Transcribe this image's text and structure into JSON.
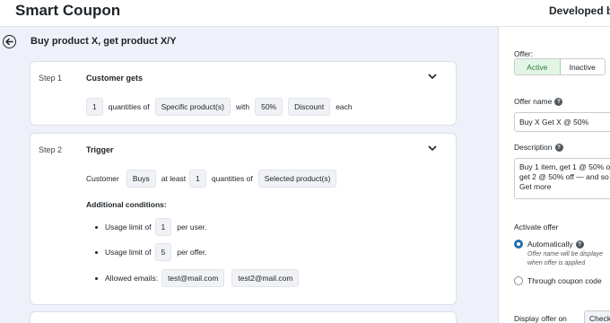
{
  "header": {
    "app_title": "Smart Coupon",
    "developed_by": "Developed by"
  },
  "page": {
    "title": "Buy product X, get product X/Y"
  },
  "step1": {
    "number": "Step 1",
    "name": "Customer gets",
    "quantity": "1",
    "t_quantities_of": "quantities of",
    "product": "Specific product(s)",
    "t_with": "with",
    "percent": "50%",
    "discount": "Discount",
    "t_each": "each"
  },
  "step2": {
    "number": "Step 2",
    "name": "Trigger",
    "t_customer": "Customer",
    "action": "Buys",
    "t_at_least": "at least",
    "quantity": "1",
    "t_quantities_of": "quantities of",
    "product": "Selected product(s)",
    "additional_title": "Additional conditions:",
    "usage_user": {
      "prefix": "Usage limit of",
      "value": "1",
      "suffix": "per user."
    },
    "usage_offer": {
      "prefix": "Usage limit of",
      "value": "5",
      "suffix": "per offer."
    },
    "emails": {
      "prefix": "Allowed emails:",
      "values": [
        "test@mail.com",
        "test2@mail.com"
      ]
    }
  },
  "sidebar": {
    "offer_label": "Offer:",
    "status_options": [
      "Active",
      "Inactive"
    ],
    "status_selected": "Active",
    "offer_name_label": "Offer name",
    "offer_name_value": "Buy X Get X @ 50%",
    "description_label": "Description",
    "description_lines": [
      "Buy 1 item, get 1 @ 50% o",
      "get 2 @ 50% off — and so",
      "Get more"
    ],
    "activate_label": "Activate offer",
    "radio_auto": "Automatically",
    "auto_hint_lines": [
      "Offer name will be displaye",
      "when offer is applied"
    ],
    "radio_coupon": "Through coupon code",
    "display_label": "Display offer on",
    "display_button": "Check"
  },
  "colors": {
    "accent": "#2271b1",
    "active_bg": "#e3f6e5",
    "active_text": "#2a7a36",
    "canvas": "#eef1f9"
  }
}
